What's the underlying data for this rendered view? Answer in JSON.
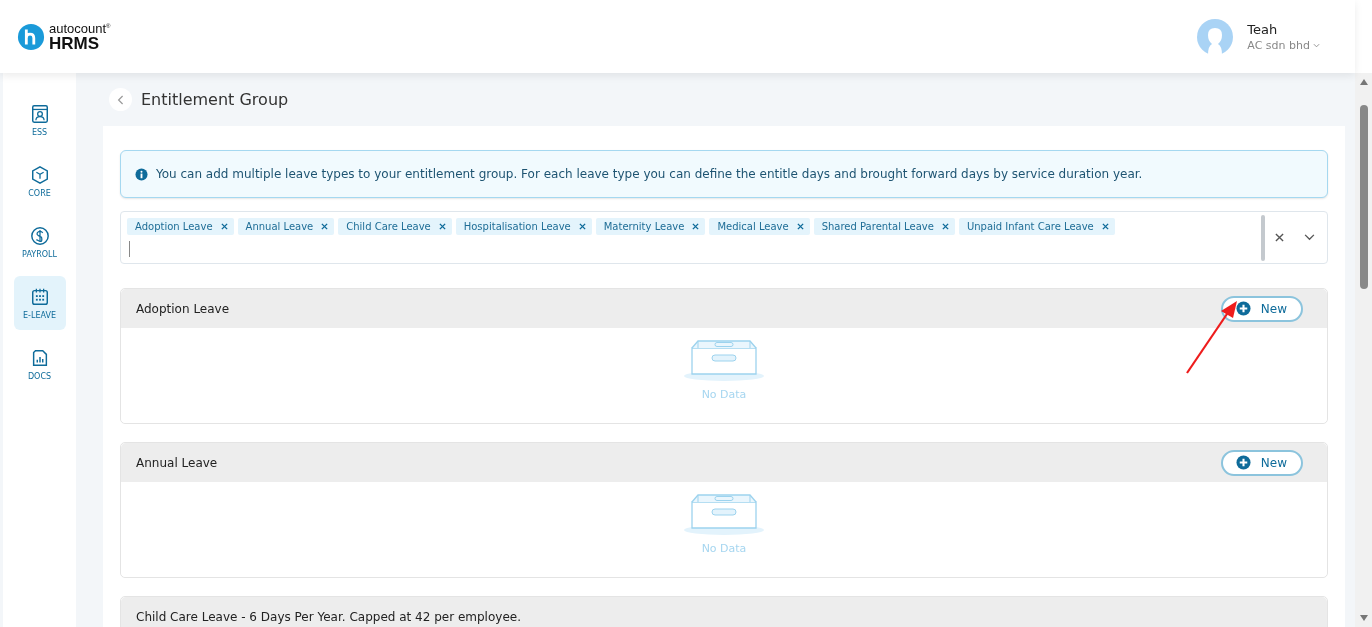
{
  "logo": {
    "top": "autocount$^{®}$",
    "bottom": "HRMS"
  },
  "user": {
    "name": "Teah",
    "company": "AC sdn bhd"
  },
  "sidebar": {
    "items": [
      {
        "label": "ESS",
        "selected": false
      },
      {
        "label": "CORE",
        "selected": false
      },
      {
        "label": "PAYROLL",
        "selected": false
      },
      {
        "label": "E-LEAVE",
        "selected": true
      },
      {
        "label": "DOCS",
        "selected": false
      }
    ]
  },
  "page": {
    "title": "Entitlement Group"
  },
  "info": "You can add multiple leave types to your entitlement group. For each leave type you can define the entitle days and brought forward days by service duration year.",
  "leave_types": [
    "Adoption Leave",
    "Annual Leave",
    "Child Care Leave",
    "Hospitalisation Leave",
    "Maternity Leave",
    "Medical Leave",
    "Shared Parental Leave",
    "Unpaid Infant Care Leave"
  ],
  "sections": [
    {
      "title": "Adoption Leave",
      "button": "New",
      "empty": "No Data",
      "annotated": true
    },
    {
      "title": "Annual Leave",
      "button": "New",
      "empty": "No Data",
      "annotated": false
    },
    {
      "title": "Child Care Leave - 6 Days Per Year. Capped at 42 per employee."
    }
  ]
}
